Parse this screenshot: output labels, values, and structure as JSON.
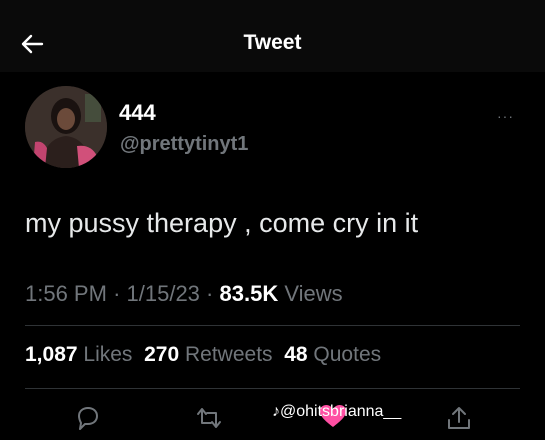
{
  "header": {
    "title": "Tweet",
    "back_icon": "arrow-left-icon"
  },
  "tweet": {
    "author_name": "444",
    "author_handle": "@prettytinyt1",
    "more_icon": "more-horizontal-icon",
    "more_text": "···",
    "text": "my pussy therapy , come cry in it",
    "time": "1:56 PM",
    "separator": "·",
    "date": "1/15/23",
    "views_count": "83.5K",
    "views_label": "Views"
  },
  "stats": {
    "likes_count": "1,087",
    "likes_label": "Likes",
    "retweets_count": "270",
    "retweets_label": "Retweets",
    "quotes_count": "48",
    "quotes_label": "Quotes"
  },
  "actions": {
    "reply_icon": "reply-icon",
    "retweet_icon": "retweet-icon",
    "like_icon": "heart-icon",
    "share_icon": "share-icon"
  },
  "watermark": {
    "text": "♪@ohitsbrianna__",
    "heart_color": "#ff4fa3"
  },
  "colors": {
    "background": "#000000",
    "primary_text": "#e7e9ea",
    "secondary_text": "#71767b",
    "divider": "#2f3336"
  }
}
